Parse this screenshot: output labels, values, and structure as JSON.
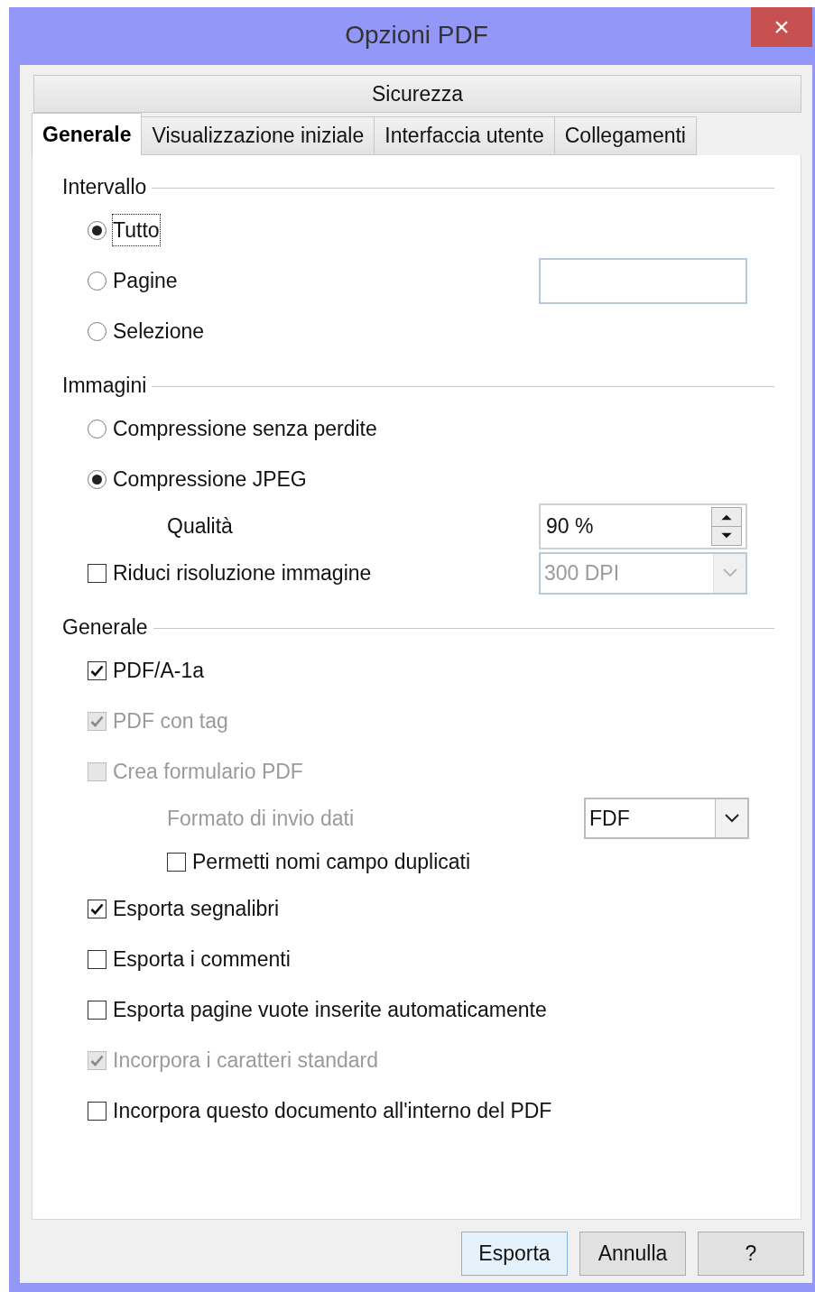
{
  "window": {
    "title": "Opzioni PDF",
    "close": "×"
  },
  "tab_rows": [
    {
      "tabs": [
        {
          "label": "Sicurezza",
          "selected": false
        }
      ]
    },
    {
      "tabs": [
        {
          "label": "Generale",
          "selected": true
        },
        {
          "label": "Visualizzazione iniziale",
          "selected": false
        },
        {
          "label": "Interfaccia utente",
          "selected": false
        },
        {
          "label": "Collegamenti",
          "selected": false
        }
      ]
    }
  ],
  "sections": [
    {
      "title": "Intervallo",
      "items": [
        {
          "kind": "radio",
          "label": "Tutto",
          "selected": true,
          "focused": true
        },
        {
          "kind": "radio",
          "label": "Pagine",
          "selected": false,
          "focused": false,
          "control": {
            "kind": "textbox"
          }
        },
        {
          "kind": "radio",
          "label": "Selezione",
          "selected": false,
          "focused": false
        }
      ]
    },
    {
      "title": "Immagini",
      "items": [
        {
          "kind": "radio",
          "label": "Compressione senza perdite",
          "selected": false,
          "focused": false
        },
        {
          "kind": "radio",
          "label": "Compressione JPEG",
          "selected": true,
          "focused": false,
          "children": [
            {
              "kind": "label",
              "label": "Qualità",
              "disabled": false,
              "control": {
                "kind": "spin",
                "value": "90 %",
                "disabled": false
              }
            }
          ]
        },
        {
          "kind": "checkbox",
          "label": "Riduci risoluzione immagine",
          "checked": false,
          "disabled": false,
          "control": {
            "kind": "dropdown",
            "value": "300 DPI",
            "disabled": true
          }
        }
      ]
    },
    {
      "title": "Generale",
      "items": [
        {
          "kind": "checkbox",
          "label": "PDF/A-1a",
          "checked": true,
          "disabled": false
        },
        {
          "kind": "checkbox",
          "label": "PDF con tag",
          "checked": true,
          "disabled": true
        },
        {
          "kind": "checkbox",
          "label": "Crea formulario PDF",
          "checked": false,
          "disabled": true,
          "children": [
            {
              "kind": "label",
              "label": "Formato di invio dati",
              "disabled": true,
              "control": {
                "kind": "dropdown",
                "value": "FDF",
                "disabled": false
              }
            },
            {
              "kind": "checkbox",
              "label": "Permetti nomi campo duplicati",
              "checked": false,
              "disabled": false
            }
          ]
        },
        {
          "kind": "checkbox",
          "label": "Esporta segnalibri",
          "checked": true,
          "disabled": false
        },
        {
          "kind": "checkbox",
          "label": "Esporta i commenti",
          "checked": false,
          "disabled": false
        },
        {
          "kind": "checkbox",
          "label": "Esporta pagine vuote inserite automaticamente",
          "checked": false,
          "disabled": false
        },
        {
          "kind": "checkbox",
          "label": "Incorpora i caratteri standard",
          "checked": true,
          "disabled": true
        },
        {
          "kind": "checkbox",
          "label": "Incorpora questo documento all'interno del PDF",
          "checked": false,
          "disabled": false
        }
      ]
    }
  ],
  "buttons": [
    {
      "label": "Esporta",
      "default": true
    },
    {
      "label": "Annulla",
      "default": false
    },
    {
      "label": "?",
      "default": false
    }
  ]
}
